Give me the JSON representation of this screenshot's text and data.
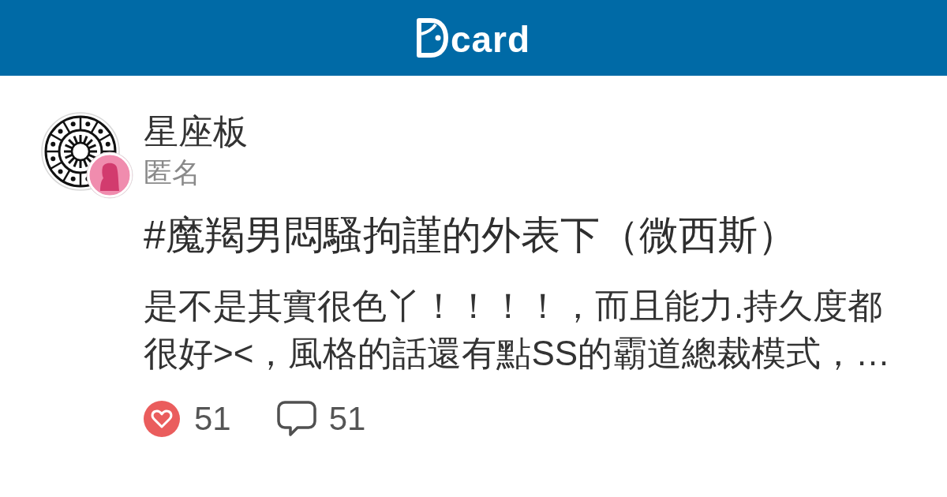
{
  "header": {
    "logo_text": "card"
  },
  "post": {
    "board": "星座板",
    "author": "匿名",
    "title": "#魔羯男悶騷拘謹的外表下（微西斯）",
    "excerpt": "是不是其實很色丫！！！！，而且能力.持久度都很好><，風格的話還有點SS的霸道總裁模式，…"
  },
  "stats": {
    "likes": "51",
    "comments": "51"
  }
}
